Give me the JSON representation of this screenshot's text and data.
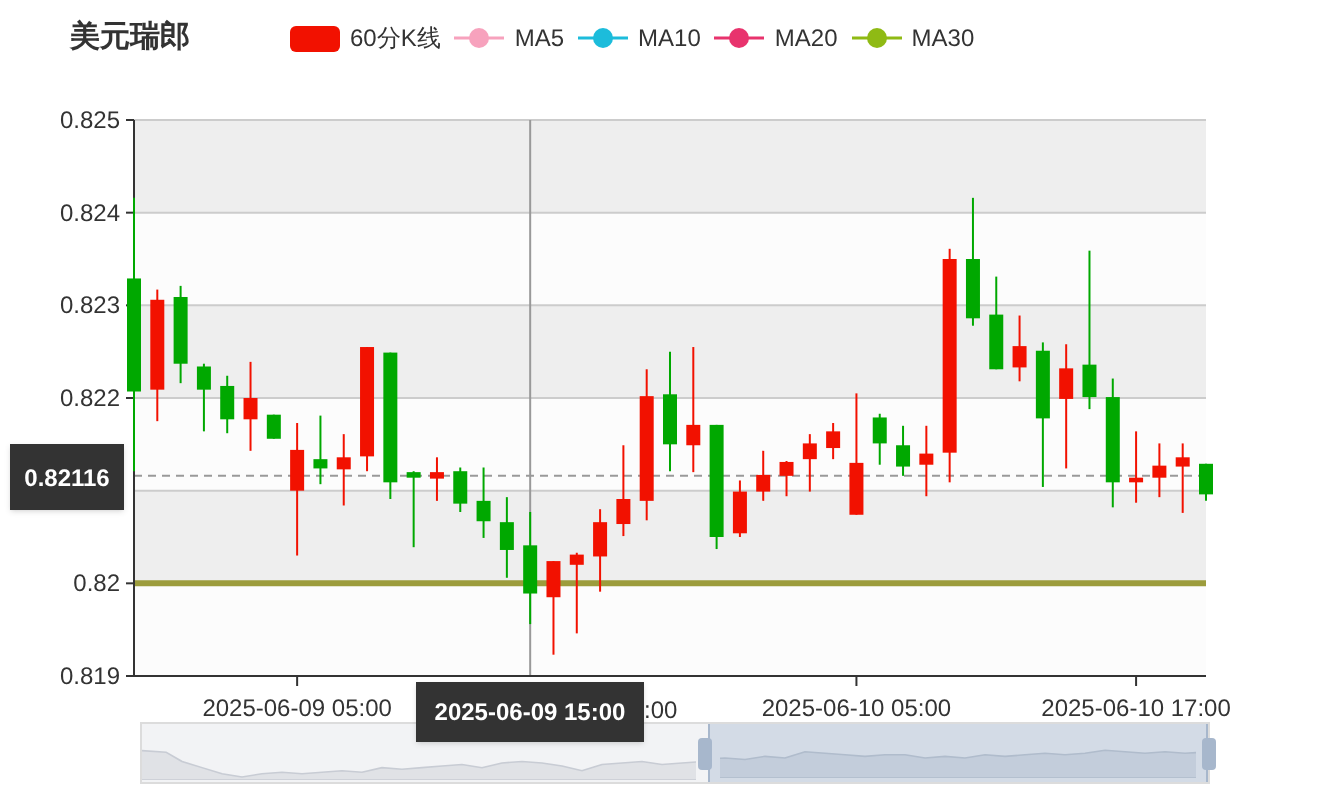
{
  "title": "美元瑞郎",
  "legend": [
    {
      "label": "60分K线",
      "kind": "candle",
      "color": "#f21100"
    },
    {
      "label": "MA5",
      "kind": "line",
      "color": "#f7a2bd"
    },
    {
      "label": "MA10",
      "kind": "line",
      "color": "#1cbcdb"
    },
    {
      "label": "MA20",
      "kind": "line",
      "color": "#e8336d"
    },
    {
      "label": "MA30",
      "kind": "line",
      "color": "#8fba14"
    }
  ],
  "chart_data": {
    "type": "candlestick",
    "ylim": [
      0.819,
      0.825
    ],
    "grid": true,
    "yticks": [
      0.819,
      {
        "value": 0.82,
        "label": "0.82"
      },
      0.822,
      0.823,
      0.824,
      0.825
    ],
    "categories": [
      null,
      null,
      null,
      null,
      null,
      null,
      null,
      "2025-06-09 05:00",
      null,
      null,
      null,
      null,
      null,
      null,
      null,
      null,
      null,
      null,
      null,
      null,
      null,
      null,
      null,
      null,
      null,
      null,
      null,
      null,
      null,
      null,
      null,
      "2025-06-10 05:00",
      null,
      null,
      null,
      null,
      null,
      null,
      null,
      null,
      null,
      null,
      null,
      "2025-06-10 17:00",
      null,
      null,
      null
    ],
    "ohlc": [
      [
        0.82329,
        0.82416,
        0.82121,
        0.82207
      ],
      [
        0.82209,
        0.82317,
        0.82175,
        0.82306
      ],
      [
        0.82309,
        0.82321,
        0.82216,
        0.82237
      ],
      [
        0.82234,
        0.82237,
        0.82164,
        0.82209
      ],
      [
        0.82213,
        0.82224,
        0.82162,
        0.82177
      ],
      [
        0.82177,
        0.82239,
        0.82143,
        0.822
      ],
      [
        0.82182,
        0.82182,
        0.82156,
        0.82156
      ],
      [
        0.821,
        0.82173,
        0.8203,
        0.82144
      ],
      [
        0.82134,
        0.82181,
        0.82107,
        0.82124
      ],
      [
        0.82123,
        0.82161,
        0.82084,
        0.82136
      ],
      [
        0.82137,
        0.82255,
        0.82121,
        0.82255
      ],
      [
        0.82249,
        0.82249,
        0.82091,
        0.82109
      ],
      [
        0.8212,
        0.82121,
        0.82039,
        0.82114
      ],
      [
        0.82113,
        0.82136,
        0.82089,
        0.8212
      ],
      [
        0.82121,
        0.82125,
        0.82077,
        0.82086
      ],
      [
        0.82089,
        0.82125,
        0.82049,
        0.82067
      ],
      [
        0.82066,
        0.82093,
        0.82006,
        0.82036
      ],
      [
        0.82041,
        0.82077,
        0.81956,
        0.81989
      ],
      [
        0.81985,
        0.82024,
        0.81923,
        0.82024
      ],
      [
        0.8202,
        0.82033,
        0.81946,
        0.82031
      ],
      [
        0.82029,
        0.8208,
        0.81991,
        0.82066
      ],
      [
        0.82064,
        0.82149,
        0.82051,
        0.82091
      ],
      [
        0.82089,
        0.82231,
        0.82068,
        0.82202
      ],
      [
        0.82204,
        0.8225,
        0.82121,
        0.8215
      ],
      [
        0.82149,
        0.82255,
        0.8212,
        0.82171
      ],
      [
        0.82171,
        0.82171,
        0.82037,
        0.8205
      ],
      [
        0.82054,
        0.82111,
        0.8205,
        0.82099
      ],
      [
        0.82099,
        0.82143,
        0.82089,
        0.82117
      ],
      [
        0.82116,
        0.82132,
        0.82094,
        0.82131
      ],
      [
        0.82134,
        0.82161,
        0.82099,
        0.82151
      ],
      [
        0.82146,
        0.82173,
        0.82134,
        0.82164
      ],
      [
        0.82074,
        0.82205,
        0.82074,
        0.8213
      ],
      [
        0.82179,
        0.82183,
        0.82128,
        0.82151
      ],
      [
        0.82149,
        0.8217,
        0.82116,
        0.82126
      ],
      [
        0.82128,
        0.8217,
        0.82094,
        0.8214
      ],
      [
        0.82141,
        0.82361,
        0.82109,
        0.8235
      ],
      [
        0.8235,
        0.82416,
        0.82278,
        0.82286
      ],
      [
        0.8229,
        0.82331,
        0.82231,
        0.82231
      ],
      [
        0.82233,
        0.82289,
        0.82218,
        0.82256
      ],
      [
        0.82251,
        0.8226,
        0.82104,
        0.82178
      ],
      [
        0.82199,
        0.82258,
        0.82124,
        0.82232
      ],
      [
        0.82236,
        0.82359,
        0.82188,
        0.82201
      ],
      [
        0.82201,
        0.82221,
        0.82082,
        0.82109
      ],
      [
        0.82109,
        0.82164,
        0.82087,
        0.82114
      ],
      [
        0.82114,
        0.82151,
        0.82093,
        0.82127
      ],
      [
        0.82126,
        0.82151,
        0.82076,
        0.82136
      ],
      [
        0.82129,
        0.82129,
        0.82089,
        0.82096
      ]
    ],
    "bands": [
      {
        "axis": "y",
        "from": 0.824,
        "to": 0.825,
        "color": "#eeeeee"
      },
      {
        "axis": "y",
        "from": 0.822,
        "to": 0.823,
        "color": "#eeeeee"
      },
      {
        "axis": "y",
        "from": 0.82,
        "to": 0.821,
        "color": "#eeeeee"
      }
    ],
    "ref_lines": [
      {
        "axis": "y",
        "value": 0.82,
        "color": "#9c9c3c"
      },
      {
        "axis": "y",
        "value": 0.82116,
        "color": "#999999",
        "label": "0.82116"
      }
    ]
  },
  "covered_axis_label": ":00",
  "time_tooltip": "2025-06-09 15:00",
  "zoom_slider": {
    "level": 0.47
  }
}
